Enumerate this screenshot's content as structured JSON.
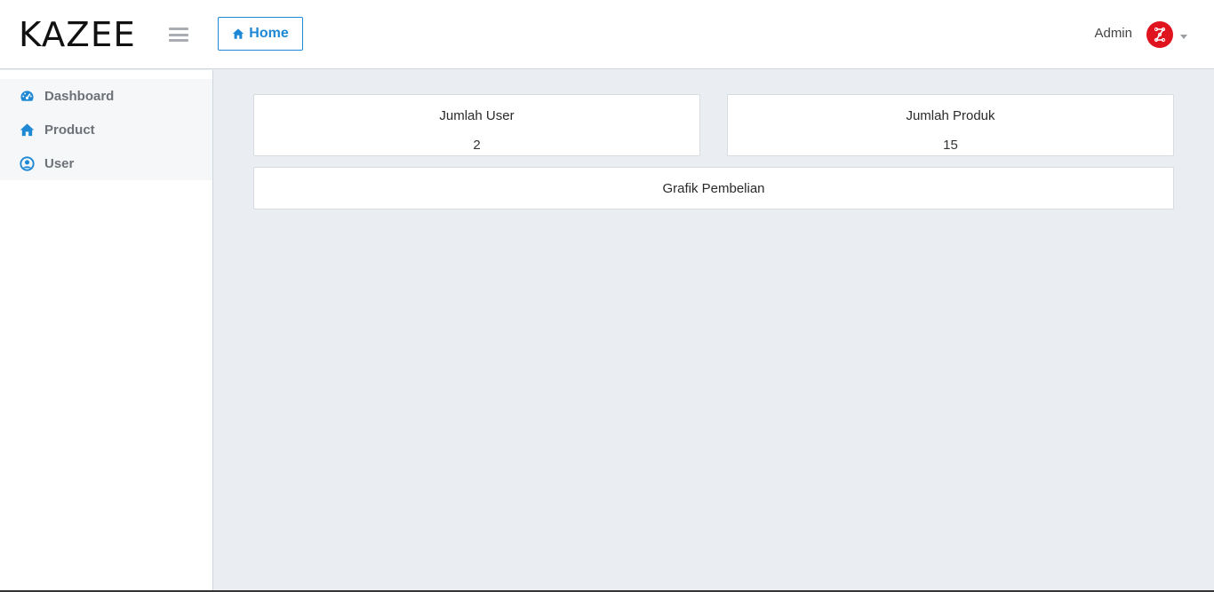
{
  "brand": {
    "logo_text": "KAZEE"
  },
  "header": {
    "home_button_label": "Home",
    "user_name": "Admin"
  },
  "sidebar": {
    "items": [
      {
        "label": "Dashboard",
        "icon": "dashboard-icon"
      },
      {
        "label": "Product",
        "icon": "home-icon"
      },
      {
        "label": "User",
        "icon": "user-circle-icon"
      }
    ]
  },
  "stats": {
    "user": {
      "title": "Jumlah User",
      "value": "2"
    },
    "produk": {
      "title": "Jumlah Produk",
      "value": "15"
    }
  },
  "chart_panel": {
    "title": "Grafik Pembelian"
  },
  "colors": {
    "accent": "#1e88d5",
    "avatar": "#e0141e",
    "background": "#eaedf1"
  }
}
